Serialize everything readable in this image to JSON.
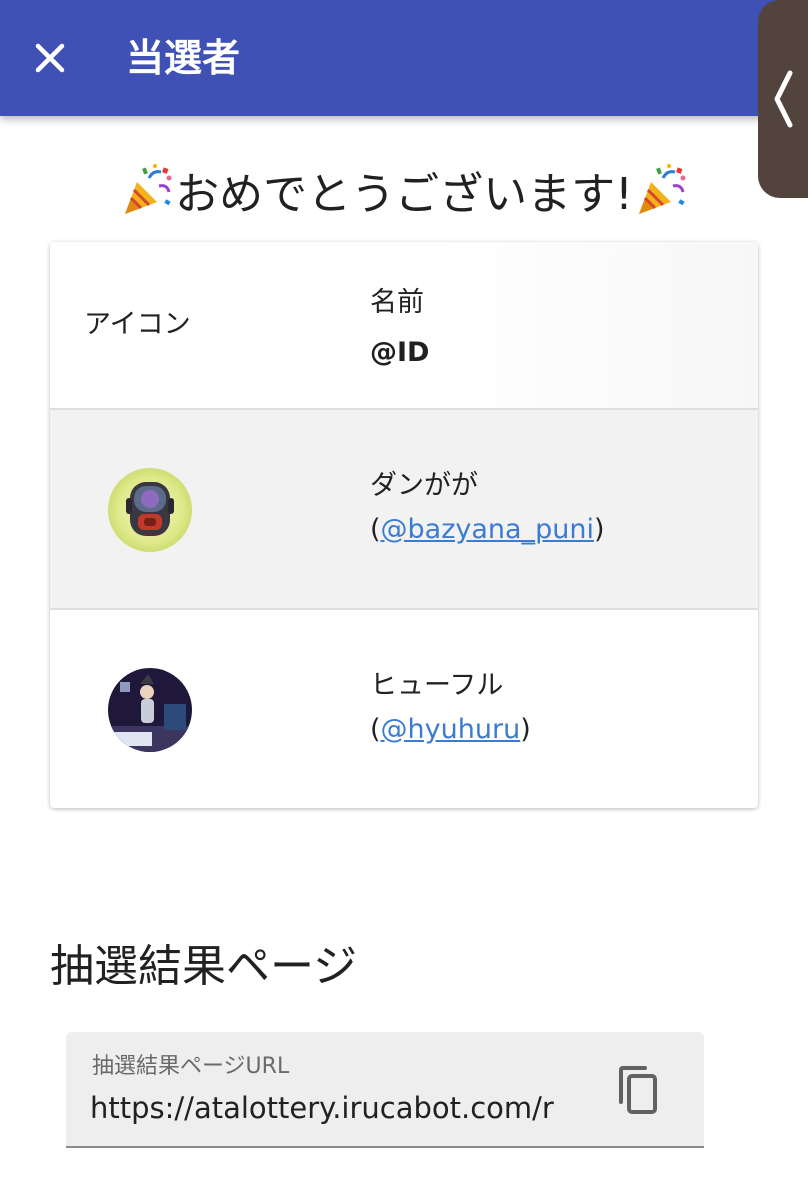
{
  "appbar": {
    "title": "当選者"
  },
  "heading": {
    "text": "おめでとうございます!"
  },
  "table": {
    "headers": {
      "icon": "アイコン",
      "name": "名前",
      "id": "@ID"
    },
    "rows": [
      {
        "name": "ダンがが",
        "open": "(",
        "handle": "@bazyana_puni",
        "close": ")"
      },
      {
        "name": "ヒューフル",
        "open": "(",
        "handle": "@hyuhuru",
        "close": ")"
      }
    ]
  },
  "result": {
    "section_title": "抽選結果ページ",
    "field_label": "抽選結果ページURL",
    "field_value": "https://atalottery.irucabot.com/r"
  },
  "colors": {
    "appbar": "#3f51b5",
    "link": "#3b7bd0",
    "edge_handle": "#52443d"
  },
  "icons": [
    "close-icon",
    "party-popper-icon",
    "chevron-left-icon",
    "copy-icon"
  ]
}
